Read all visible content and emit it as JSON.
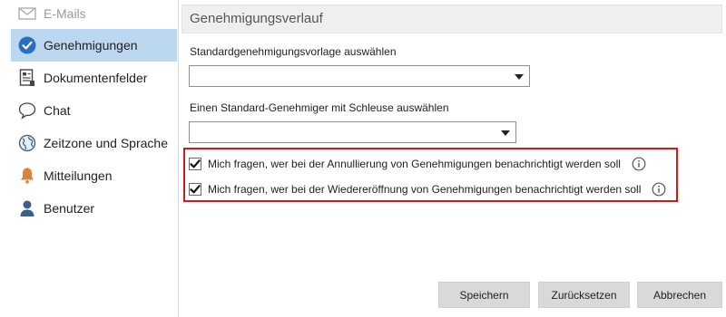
{
  "sidebar": {
    "items": [
      {
        "label": "E-Mails",
        "icon": "envelope-icon"
      },
      {
        "label": "Genehmigungen",
        "icon": "checkmark-circle-icon",
        "active": true
      },
      {
        "label": "Dokumentenfelder",
        "icon": "document-fields-icon"
      },
      {
        "label": "Chat",
        "icon": "chat-bubble-icon"
      },
      {
        "label": "Zeitzone und Sprache",
        "icon": "globe-icon"
      },
      {
        "label": "Mitteilungen",
        "icon": "bell-icon"
      },
      {
        "label": "Benutzer",
        "icon": "user-icon"
      }
    ]
  },
  "main": {
    "title": "Genehmigungsverlauf",
    "template_label": "Standardgenehmigungsvorlage auswählen",
    "template_value": "",
    "approver_label": "Einen Standard-Genehmiger mit Schleuse auswählen",
    "approver_value": "",
    "checkboxes": [
      {
        "label": "Mich fragen, wer bei der Annullierung von Genehmigungen benachrichtigt werden soll",
        "checked": true
      },
      {
        "label": "Mich fragen, wer bei der Wiedereröffnung von Genehmigungen benachrichtigt werden soll",
        "checked": true
      }
    ]
  },
  "buttons": {
    "save": "Speichern",
    "reset": "Zurücksetzen",
    "cancel": "Abbrechen"
  },
  "colors": {
    "accent": "#2b6fc2",
    "active_bg": "#bcd8f1",
    "highlight_border": "#d21919",
    "bell": "#d9823b"
  }
}
